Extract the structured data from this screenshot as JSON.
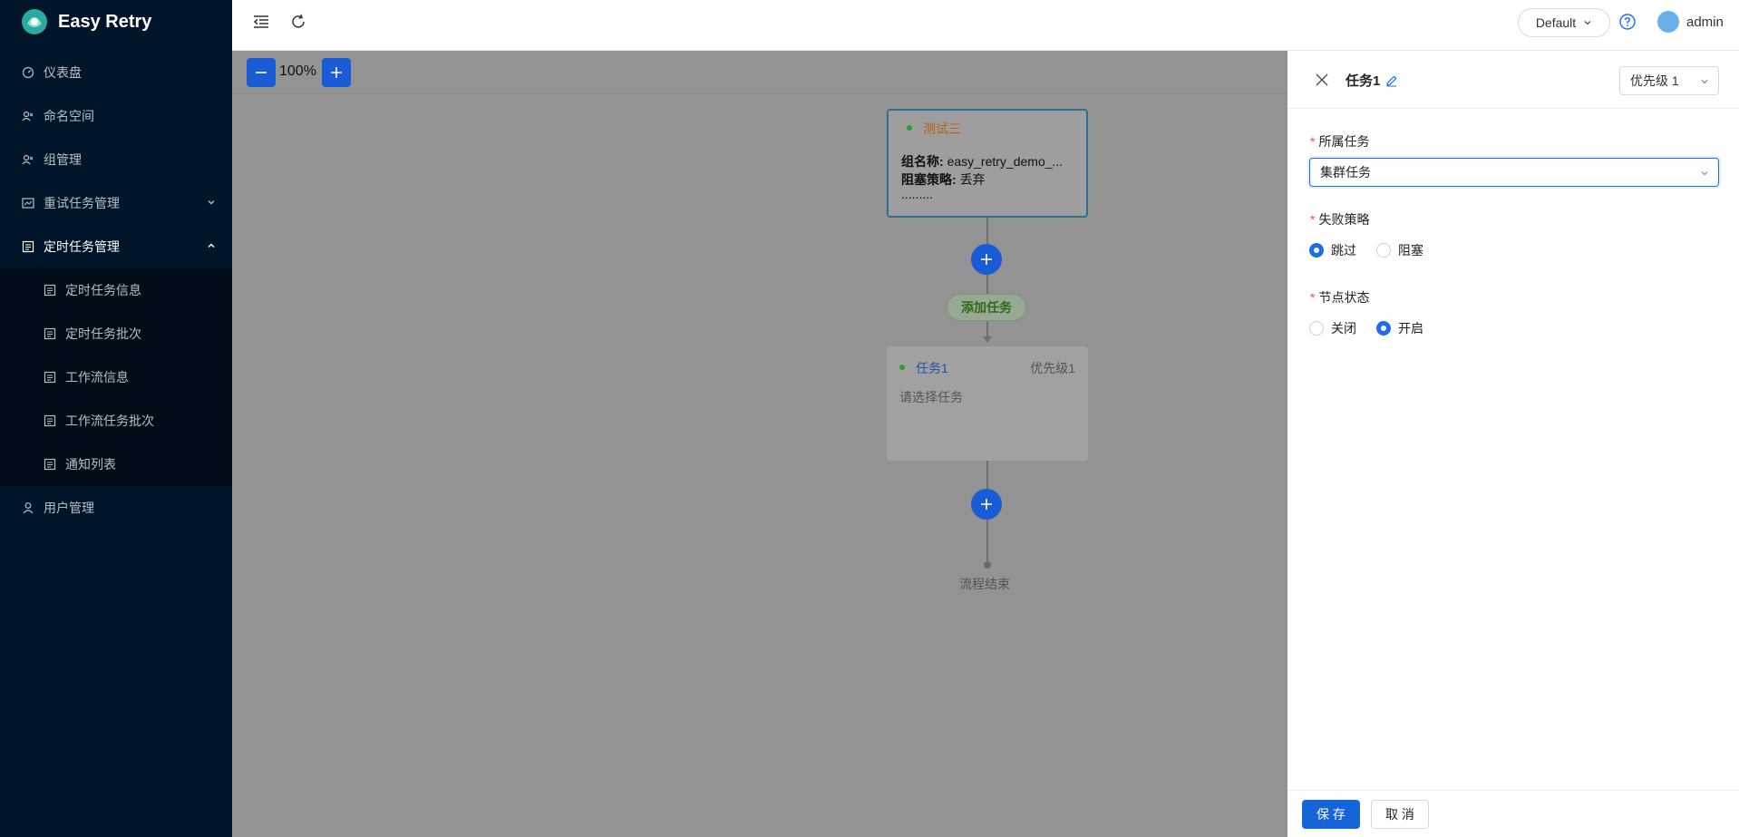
{
  "app": {
    "title": "Easy Retry"
  },
  "sidebar": {
    "items": [
      {
        "label": "仪表盘",
        "icon": "dashboard-icon"
      },
      {
        "label": "命名空间",
        "icon": "namespace-icon"
      },
      {
        "label": "组管理",
        "icon": "group-icon"
      },
      {
        "label": "重试任务管理",
        "icon": "retry-icon",
        "expandable": true
      },
      {
        "label": "定时任务管理",
        "icon": "schedule-icon",
        "expanded": true
      }
    ],
    "subitems": [
      {
        "label": "定时任务信息"
      },
      {
        "label": "定时任务批次"
      },
      {
        "label": "工作流信息"
      },
      {
        "label": "工作流任务批次"
      },
      {
        "label": "通知列表"
      }
    ],
    "user_mgmt": {
      "label": "用户管理"
    }
  },
  "header": {
    "env": "Default",
    "user": "admin"
  },
  "canvas": {
    "zoom": "100%",
    "start_node": {
      "title": "测试三",
      "group_label": "组名称:",
      "group_value": "easy_retry_demo_...",
      "block_label": "阻塞策略:",
      "block_value": "丢弃",
      "more": "........."
    },
    "add_task": "添加任务",
    "task_node": {
      "title": "任务1",
      "priority": "优先级1",
      "hint": "请选择任务"
    },
    "end_label": "流程结束"
  },
  "drawer": {
    "title": "任务1",
    "priority_select": "优先级 1",
    "task_label": "所属任务",
    "task_value": "集群任务",
    "fail_label": "失败策略",
    "fail_options": [
      "跳过",
      "阻塞"
    ],
    "fail_selected": 0,
    "status_label": "节点状态",
    "status_options": [
      "关闭",
      "开启"
    ],
    "status_selected": 1,
    "save": "保 存",
    "cancel": "取 消"
  },
  "colors": {
    "sidebar_bg": "#001529",
    "primary": "#1a5bd6",
    "required": "#ff4d4f"
  }
}
